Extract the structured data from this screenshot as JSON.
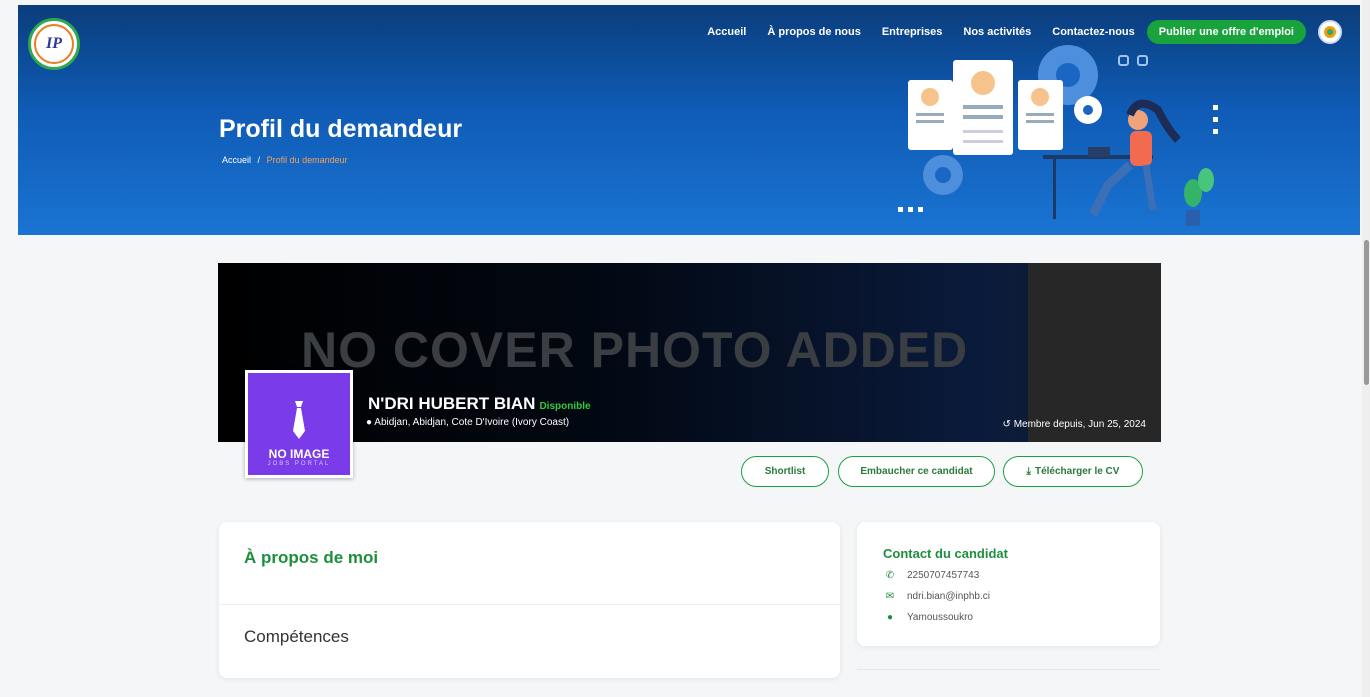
{
  "header": {
    "logo_text": "IP",
    "nav": [
      "Accueil",
      "À propos de nous",
      "Entreprises",
      "Nos activités",
      "Contactez-nous"
    ],
    "cta_label": "Publier une offre d'emploi",
    "title": "Profil du demandeur",
    "breadcrumb": {
      "home": "Accueil",
      "sep": "/",
      "current": "Profil du demandeur"
    }
  },
  "profile": {
    "cover_text": "NO COVER PHOTO ADDED",
    "name": "N'DRI HUBERT BIAN",
    "status": "Disponible",
    "location": "Abidjan, Abidjan, Cote D'Ivoire (Ivory Coast)",
    "member_since": "Membre depuis, Jun 25, 2024",
    "avatar_title": "NO IMAGE",
    "avatar_sub": "JOBS PORTAL"
  },
  "actions": {
    "shortlist": "Shortlist",
    "hire": "Embaucher ce candidat",
    "download": "Télécharger le CV"
  },
  "about": {
    "title": "À propos de moi",
    "skills_title": "Compétences"
  },
  "contact": {
    "title": "Contact du candidat",
    "phone": "2250707457743",
    "email": "ndri.bian@inphb.ci",
    "city": "Yamoussoukro"
  },
  "colors": {
    "accent": "#1e9f44",
    "hero": "#0f5bb5",
    "avatar": "#7a3ce8"
  },
  "icons": [
    "phone-icon",
    "envelope-icon",
    "map-marker-icon",
    "download-icon",
    "history-icon",
    "tie-icon"
  ]
}
